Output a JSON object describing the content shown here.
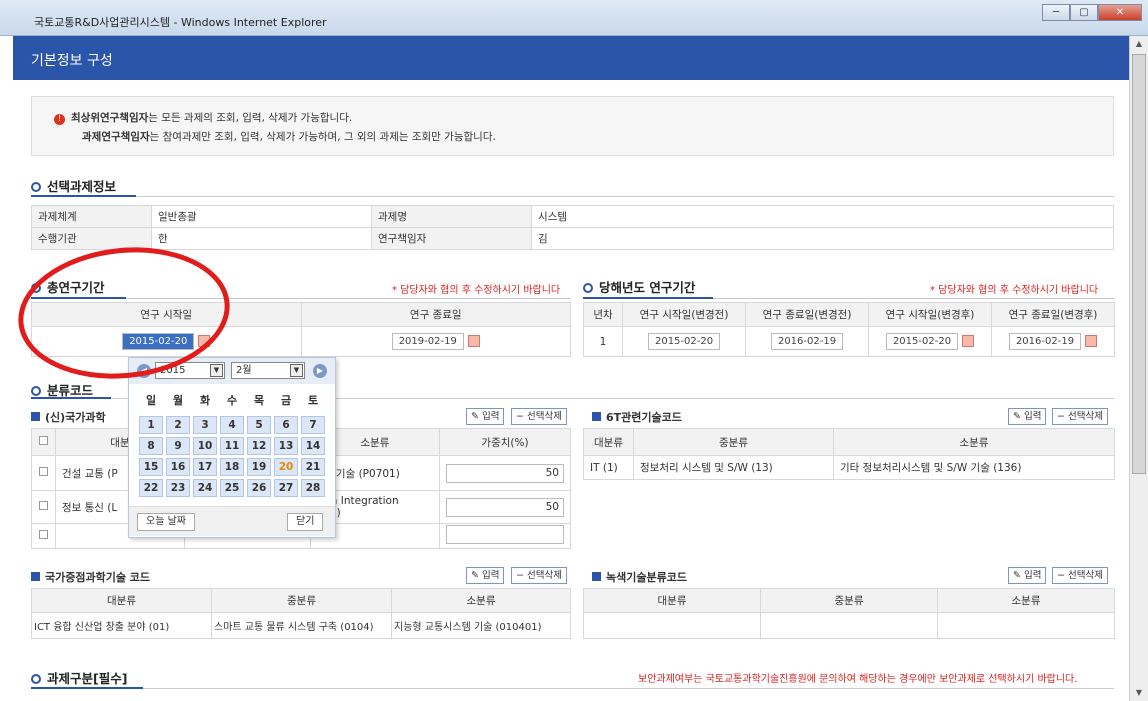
{
  "window": {
    "title": "국토교통R&D사업관리시스템 - Windows Internet Explorer",
    "min": "─",
    "max": "▢",
    "close": "✕"
  },
  "header": {
    "title": "기본정보 구성"
  },
  "notice": {
    "l1_bold": "최상위연구책임자",
    "l1_rest": "는 모든 과제의 조회, 입력, 삭제가 가능합니다.",
    "l2_bold": "과제연구책임자",
    "l2_rest": "는 참여과제만 조회, 입력, 삭제가 가능하며, 그 외의 과제는 조회만 가능합니다."
  },
  "selected": {
    "title": "선택과제정보",
    "r1": [
      "과제체계",
      "일반총괄",
      "과제명",
      "시스템"
    ],
    "r2": [
      "수행기관",
      "한",
      "연구책임자",
      "김"
    ]
  },
  "total": {
    "title": "총연구기간",
    "note": "* 담당자와 협의 후 수정하시기 바랍니다",
    "h1": "연구 시작일",
    "h2": "연구 종료일",
    "start": "2015-02-20",
    "end": "2019-02-19"
  },
  "year": {
    "title": "당해년도 연구기간",
    "note": "* 담당자와 협의 후 수정하시기 바랍니다",
    "headers": [
      "년차",
      "연구 시작일(변경전)",
      "연구 종료일(변경전)",
      "연구 시작일(변경후)",
      "연구 종료일(변경후)"
    ],
    "row": [
      "1",
      "2015-02-20",
      "2016-02-19",
      "2015-02-20",
      "2016-02-19"
    ]
  },
  "classcode": {
    "title": "분류코드"
  },
  "nat": {
    "title": "(신)국가과학",
    "h_big": "대분",
    "h_small": "소분류",
    "h_weight": "가중치(%)",
    "rows": [
      {
        "big": "건설 교통 (P",
        "small": "안전기술 (P0701)",
        "w": "50"
      },
      {
        "big": "정보 통신 (L",
        "small": "tem Integration\n203)",
        "w": "50"
      },
      {
        "big": "",
        "small": "",
        "w": ""
      }
    ]
  },
  "buttons": {
    "input": "입력",
    "del": "선택삭제"
  },
  "sixt": {
    "title": "6T관련기술코드",
    "headers": [
      "대분류",
      "중분류",
      "소분류"
    ],
    "row": [
      "IT (1)",
      "정보처리 시스템 및 S/W (13)",
      "기타 정보처리시스템 및 S/W 기술 (136)"
    ]
  },
  "key": {
    "title": "국가중점과학기술 코드",
    "headers": [
      "대분류",
      "중분류",
      "소분류"
    ],
    "row": [
      "ICT 융합 신산업 창출 분야 (01)",
      "스마트 교통 물류 시스템 구축 (0104)",
      "지능형 교통시스템 기술 (010401)"
    ]
  },
  "green": {
    "title": "녹색기술분류코드",
    "headers": [
      "대분류",
      "중분류",
      "소분류"
    ]
  },
  "category": {
    "title": "과제구분[필수]",
    "note": "보안과제여부는 국토교통과학기술진흥원에 문의하여 해당하는 경우에만 보안과제로 선택하시기 바랍니다."
  },
  "calendar": {
    "year": "2015",
    "month": "2월",
    "dow": [
      "일",
      "월",
      "화",
      "수",
      "목",
      "금",
      "토"
    ],
    "days": [
      [
        "1",
        "2",
        "3",
        "4",
        "5",
        "6",
        "7"
      ],
      [
        "8",
        "9",
        "10",
        "11",
        "12",
        "13",
        "14"
      ],
      [
        "15",
        "16",
        "17",
        "18",
        "19",
        "20",
        "21"
      ],
      [
        "22",
        "23",
        "24",
        "25",
        "26",
        "27",
        "28"
      ]
    ],
    "today": "20",
    "today_btn": "오늘 날짜",
    "close_btn": "닫기",
    "prev": "◀",
    "next": "▶"
  },
  "colors": {
    "accent": "#2b55a9",
    "red": "#e0201e",
    "highlight": "#e21b1b"
  }
}
